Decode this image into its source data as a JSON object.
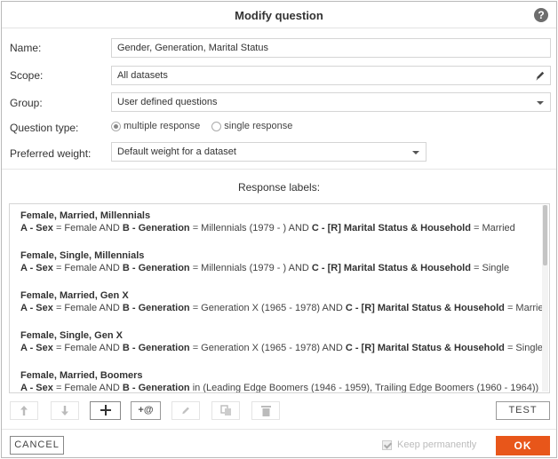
{
  "dialog": {
    "title": "Modify question",
    "help": "?"
  },
  "form": {
    "name_label": "Name:",
    "name_value": "Gender, Generation, Marital Status",
    "scope_label": "Scope:",
    "scope_value": "All datasets",
    "group_label": "Group:",
    "group_value": "User defined questions",
    "question_type_label": "Question type:",
    "question_type_options": [
      "multiple response",
      "single response"
    ],
    "question_type_selected": "multiple response",
    "weight_label": "Preferred weight:",
    "weight_value": "Default weight for a dataset"
  },
  "responses": {
    "title": "Response labels:",
    "items": [
      {
        "title": "Female, Married, Millennials",
        "rule": [
          {
            "t": "A - Sex",
            "b": true
          },
          {
            "t": " = Female AND ",
            "b": false
          },
          {
            "t": "B - Generation",
            "b": true
          },
          {
            "t": " = Millennials (1979 - ) AND ",
            "b": false
          },
          {
            "t": "C - [R] Marital Status & Household",
            "b": true
          },
          {
            "t": " = Married",
            "b": false
          }
        ]
      },
      {
        "title": "Female, Single, Millennials",
        "rule": [
          {
            "t": "A - Sex",
            "b": true
          },
          {
            "t": " = Female AND ",
            "b": false
          },
          {
            "t": "B - Generation",
            "b": true
          },
          {
            "t": " = Millennials (1979 - ) AND ",
            "b": false
          },
          {
            "t": "C - [R] Marital Status & Household",
            "b": true
          },
          {
            "t": " = Single",
            "b": false
          }
        ]
      },
      {
        "title": "Female, Married, Gen X",
        "rule": [
          {
            "t": "A - Sex",
            "b": true
          },
          {
            "t": " = Female AND ",
            "b": false
          },
          {
            "t": "B - Generation",
            "b": true
          },
          {
            "t": " = Generation X (1965 - 1978) AND ",
            "b": false
          },
          {
            "t": "C - [R] Marital Status & Household",
            "b": true
          },
          {
            "t": " = Married",
            "b": false
          }
        ]
      },
      {
        "title": "Female, Single, Gen X",
        "rule": [
          {
            "t": "A - Sex",
            "b": true
          },
          {
            "t": " = Female AND ",
            "b": false
          },
          {
            "t": "B - Generation",
            "b": true
          },
          {
            "t": " = Generation X (1965 - 1978) AND ",
            "b": false
          },
          {
            "t": "C - [R] Marital Status & Household",
            "b": true
          },
          {
            "t": " = Single",
            "b": false
          }
        ]
      },
      {
        "title": "Female, Married, Boomers",
        "rule": [
          {
            "t": "A - Sex",
            "b": true
          },
          {
            "t": " = Female AND ",
            "b": false
          },
          {
            "t": "B - Generation",
            "b": true
          },
          {
            "t": " in (Leading Edge Boomers (1946 - 1959), Trailing Edge Boomers (1960 - 1964))",
            "b": false
          }
        ]
      }
    ]
  },
  "toolbar": {
    "move_up_icon": "arrow-up-icon",
    "move_down_icon": "arrow-down-icon",
    "add_icon": "plus-icon",
    "add_at_label": "+@",
    "edit_icon": "pencil-icon",
    "copy_icon": "copy-icon",
    "delete_icon": "trash-icon",
    "test_label": "TEST"
  },
  "footer": {
    "cancel_label": "CANCEL",
    "keep_label": "Keep permanently",
    "keep_checked": true,
    "ok_label": "OK"
  },
  "colors": {
    "ok_button": "#e8561a",
    "border": "#d5d5d5"
  }
}
